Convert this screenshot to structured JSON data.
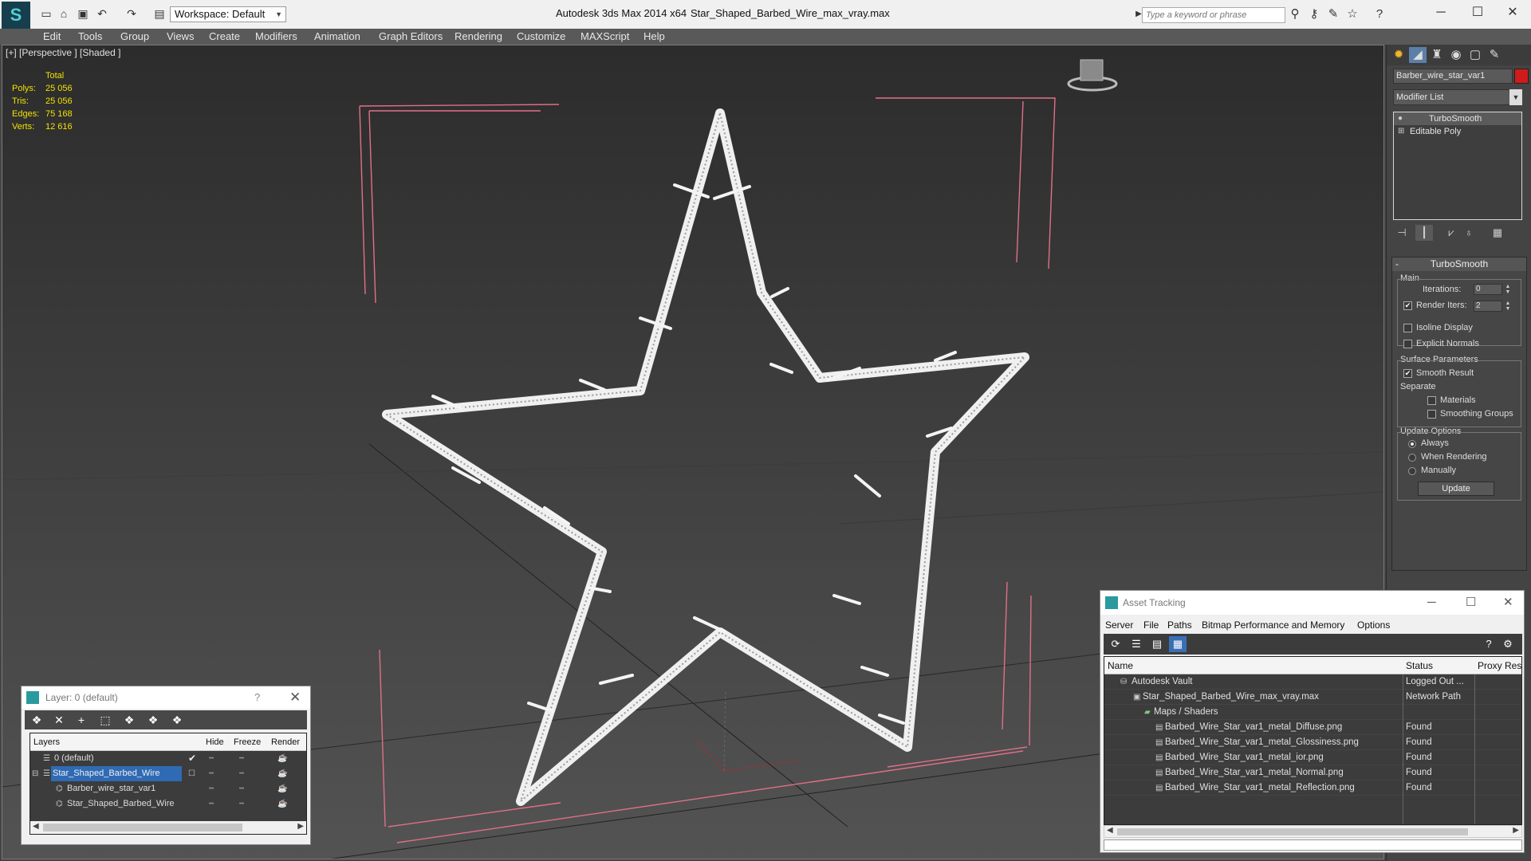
{
  "titlebar": {
    "workspace_label": "Workspace: Default",
    "app_title": "Autodesk 3ds Max  2014 x64",
    "file_title": "Star_Shaped_Barbed_Wire_max_vray.max",
    "search_placeholder": "Type a keyword or phrase"
  },
  "menu": [
    "Edit",
    "Tools",
    "Group",
    "Views",
    "Create",
    "Modifiers",
    "Animation",
    "Graph Editors",
    "Rendering",
    "Customize",
    "MAXScript",
    "Help"
  ],
  "viewport": {
    "label": "[+] [Perspective ] [Shaded ]",
    "stats": {
      "header": "Total",
      "polys_label": "Polys:",
      "polys": "25 056",
      "tris_label": "Tris:",
      "tris": "25 056",
      "edges_label": "Edges:",
      "edges": "75 168",
      "verts_label": "Verts:",
      "verts": "12 616"
    }
  },
  "command_panel": {
    "object_name": "Barber_wire_star_var1",
    "object_color": "#d11a1a",
    "modifier_list": "Modifier List",
    "stack": [
      "TurboSmooth",
      "Editable Poly"
    ],
    "rollout_title": "TurboSmooth",
    "main_label": "Main",
    "iterations_label": "Iterations:",
    "iterations_value": "0",
    "render_iters_label": "Render Iters:",
    "render_iters_value": "2",
    "isoline_label": "Isoline Display",
    "explicit_normals_label": "Explicit Normals",
    "surface_params_label": "Surface Parameters",
    "smooth_result_label": "Smooth Result",
    "separate_label": "Separate",
    "materials_label": "Materials",
    "smoothing_groups_label": "Smoothing Groups",
    "update_options_label": "Update Options",
    "always_label": "Always",
    "when_rendering_label": "When Rendering",
    "manually_label": "Manually",
    "update_button": "Update"
  },
  "layer_window": {
    "title": "Layer: 0 (default)",
    "help": "?",
    "columns": [
      "Layers",
      "Hide",
      "Freeze",
      "Render"
    ],
    "rows": [
      {
        "name": "0 (default)"
      },
      {
        "name": "Star_Shaped_Barbed_Wire"
      },
      {
        "name": "Barber_wire_star_var1"
      },
      {
        "name": "Star_Shaped_Barbed_Wire"
      }
    ]
  },
  "asset_window": {
    "title": "Asset Tracking",
    "menu": [
      "Server",
      "File",
      "Paths",
      "Bitmap Performance and Memory",
      "Options"
    ],
    "columns": [
      "Name",
      "Status",
      "Proxy Reso"
    ],
    "rows": [
      {
        "name": "Autodesk Vault",
        "status": "Logged Out ..."
      },
      {
        "name": "Star_Shaped_Barbed_Wire_max_vray.max",
        "status": "Network Path"
      },
      {
        "name": "Maps / Shaders",
        "status": ""
      },
      {
        "name": "Barbed_Wire_Star_var1_metal_Diffuse.png",
        "status": "Found"
      },
      {
        "name": "Barbed_Wire_Star_var1_metal_Glossiness.png",
        "status": "Found"
      },
      {
        "name": "Barbed_Wire_Star_var1_metal_ior.png",
        "status": "Found"
      },
      {
        "name": "Barbed_Wire_Star_var1_metal_Normal.png",
        "status": "Found"
      },
      {
        "name": "Barbed_Wire_Star_var1_metal_Reflection.png",
        "status": "Found"
      }
    ]
  }
}
